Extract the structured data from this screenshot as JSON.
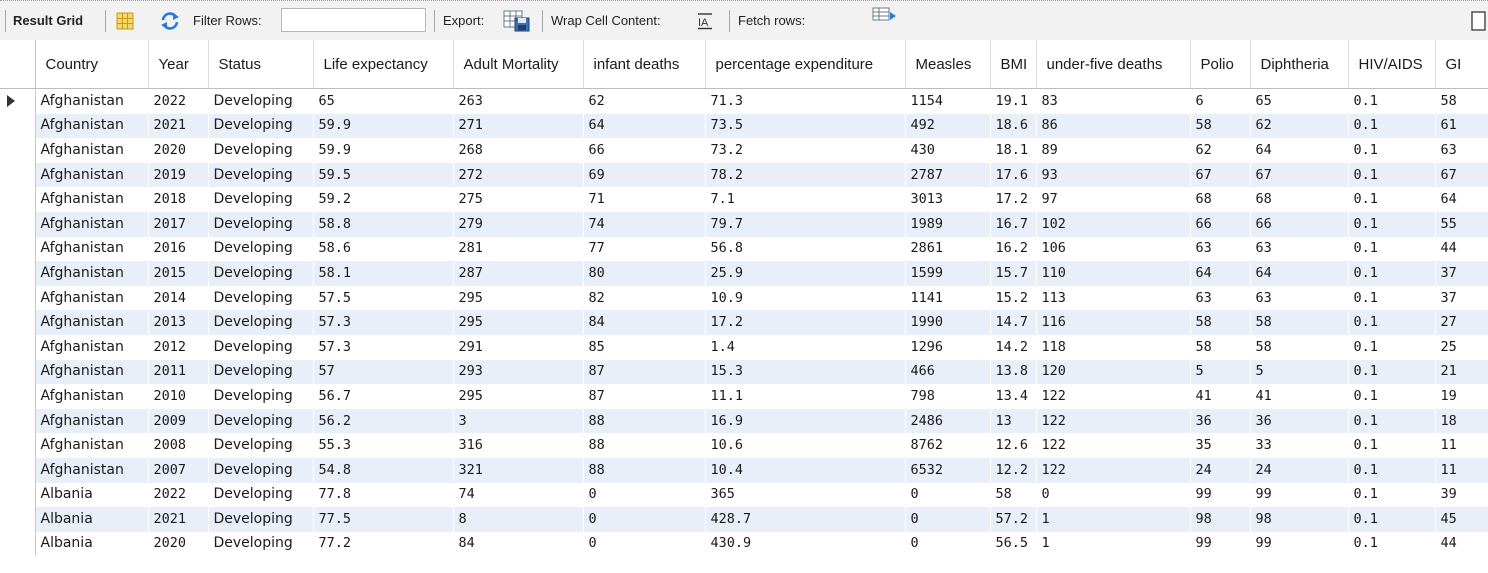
{
  "toolbar": {
    "result_grid": "Result Grid",
    "filter_rows": "Filter Rows:",
    "export": "Export:",
    "wrap_cell_content": "Wrap Cell Content:",
    "fetch_rows": "Fetch rows:",
    "filter_value": "",
    "icons": [
      "grid-layout-icon",
      "refresh-icon",
      "export-icon",
      "wrap-text-icon",
      "fetch-rows-icon",
      "panel-toggle-icon"
    ]
  },
  "grid": {
    "columns": [
      {
        "key": "country",
        "label": "Country"
      },
      {
        "key": "year",
        "label": "Year"
      },
      {
        "key": "status",
        "label": "Status"
      },
      {
        "key": "life",
        "label": "Life expectancy"
      },
      {
        "key": "adult",
        "label": "Adult Mortality"
      },
      {
        "key": "infant",
        "label": "infant deaths"
      },
      {
        "key": "pct",
        "label": "percentage expenditure"
      },
      {
        "key": "measles",
        "label": "Measles"
      },
      {
        "key": "bmi",
        "label": "BMI"
      },
      {
        "key": "u5",
        "label": "under-five deaths"
      },
      {
        "key": "polio",
        "label": "Polio"
      },
      {
        "key": "diph",
        "label": "Diphtheria"
      },
      {
        "key": "hiv",
        "label": "HIV/AIDS"
      },
      {
        "key": "gdp",
        "label": "GI"
      }
    ],
    "selected_row": 0,
    "rows": [
      [
        "Afghanistan",
        "2022",
        "Developing",
        "65",
        "263",
        "62",
        "71.3",
        "1154",
        "19.1",
        "83",
        "6",
        "65",
        "0.1",
        "58"
      ],
      [
        "Afghanistan",
        "2021",
        "Developing",
        "59.9",
        "271",
        "64",
        "73.5",
        "492",
        "18.6",
        "86",
        "58",
        "62",
        "0.1",
        "61"
      ],
      [
        "Afghanistan",
        "2020",
        "Developing",
        "59.9",
        "268",
        "66",
        "73.2",
        "430",
        "18.1",
        "89",
        "62",
        "64",
        "0.1",
        "63"
      ],
      [
        "Afghanistan",
        "2019",
        "Developing",
        "59.5",
        "272",
        "69",
        "78.2",
        "2787",
        "17.6",
        "93",
        "67",
        "67",
        "0.1",
        "67"
      ],
      [
        "Afghanistan",
        "2018",
        "Developing",
        "59.2",
        "275",
        "71",
        "7.1",
        "3013",
        "17.2",
        "97",
        "68",
        "68",
        "0.1",
        "64"
      ],
      [
        "Afghanistan",
        "2017",
        "Developing",
        "58.8",
        "279",
        "74",
        "79.7",
        "1989",
        "16.7",
        "102",
        "66",
        "66",
        "0.1",
        "55"
      ],
      [
        "Afghanistan",
        "2016",
        "Developing",
        "58.6",
        "281",
        "77",
        "56.8",
        "2861",
        "16.2",
        "106",
        "63",
        "63",
        "0.1",
        "44"
      ],
      [
        "Afghanistan",
        "2015",
        "Developing",
        "58.1",
        "287",
        "80",
        "25.9",
        "1599",
        "15.7",
        "110",
        "64",
        "64",
        "0.1",
        "37"
      ],
      [
        "Afghanistan",
        "2014",
        "Developing",
        "57.5",
        "295",
        "82",
        "10.9",
        "1141",
        "15.2",
        "113",
        "63",
        "63",
        "0.1",
        "37"
      ],
      [
        "Afghanistan",
        "2013",
        "Developing",
        "57.3",
        "295",
        "84",
        "17.2",
        "1990",
        "14.7",
        "116",
        "58",
        "58",
        "0.1",
        "27"
      ],
      [
        "Afghanistan",
        "2012",
        "Developing",
        "57.3",
        "291",
        "85",
        "1.4",
        "1296",
        "14.2",
        "118",
        "58",
        "58",
        "0.1",
        "25"
      ],
      [
        "Afghanistan",
        "2011",
        "Developing",
        "57",
        "293",
        "87",
        "15.3",
        "466",
        "13.8",
        "120",
        "5",
        "5",
        "0.1",
        "21"
      ],
      [
        "Afghanistan",
        "2010",
        "Developing",
        "56.7",
        "295",
        "87",
        "11.1",
        "798",
        "13.4",
        "122",
        "41",
        "41",
        "0.1",
        "19"
      ],
      [
        "Afghanistan",
        "2009",
        "Developing",
        "56.2",
        "3",
        "88",
        "16.9",
        "2486",
        "13",
        "122",
        "36",
        "36",
        "0.1",
        "18"
      ],
      [
        "Afghanistan",
        "2008",
        "Developing",
        "55.3",
        "316",
        "88",
        "10.6",
        "8762",
        "12.6",
        "122",
        "35",
        "33",
        "0.1",
        "11"
      ],
      [
        "Afghanistan",
        "2007",
        "Developing",
        "54.8",
        "321",
        "88",
        "10.4",
        "6532",
        "12.2",
        "122",
        "24",
        "24",
        "0.1",
        "11"
      ],
      [
        "Albania",
        "2022",
        "Developing",
        "77.8",
        "74",
        "0",
        "365",
        "0",
        "58",
        "0",
        "99",
        "99",
        "0.1",
        "39"
      ],
      [
        "Albania",
        "2021",
        "Developing",
        "77.5",
        "8",
        "0",
        "428.7",
        "0",
        "57.2",
        "1",
        "98",
        "98",
        "0.1",
        "45"
      ],
      [
        "Albania",
        "2020",
        "Developing",
        "77.2",
        "84",
        "0",
        "430.9",
        "0",
        "56.5",
        "1",
        "99",
        "99",
        "0.1",
        "44"
      ]
    ]
  },
  "colors": {
    "alt_row": "#e9eff9",
    "toolbar_bg": "#f2f2f2",
    "accent": "#2b7bd6"
  }
}
